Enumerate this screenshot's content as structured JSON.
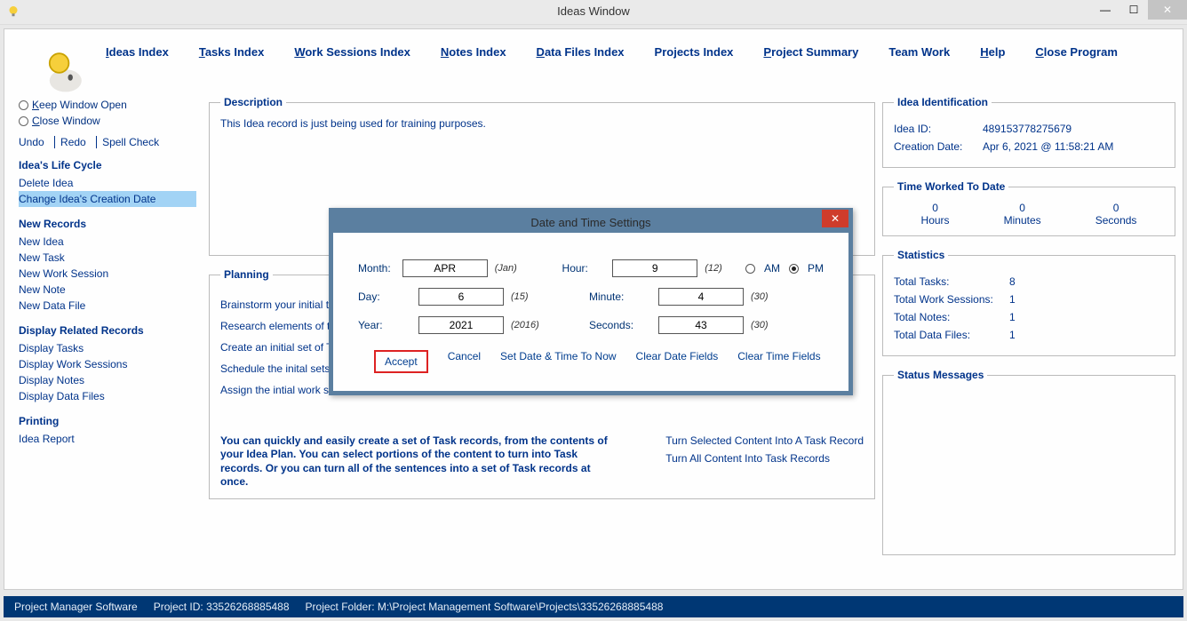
{
  "window": {
    "title": "Ideas Window"
  },
  "menu": {
    "items": [
      "Ideas Index",
      "Tasks Index",
      "Work Sessions Index",
      "Notes Index",
      "Data Files Index",
      "Projects Index",
      "Project Summary",
      "Team Work",
      "Help",
      "Close Program"
    ]
  },
  "left": {
    "keep_open": "Keep Window Open",
    "close_window": "Close Window",
    "undo": "Undo",
    "redo": "Redo",
    "spell": "Spell Check",
    "life_cycle_header": "Idea's Life Cycle",
    "delete_idea": "Delete Idea",
    "change_date": "Change Idea's Creation Date",
    "new_records_header": "New Records",
    "new_idea": "New Idea",
    "new_task": "New Task",
    "new_ws": "New Work Session",
    "new_note": "New Note",
    "new_df": "New Data File",
    "display_header": "Display Related Records",
    "disp_tasks": "Display Tasks",
    "disp_ws": "Display Work Sessions",
    "disp_notes": "Display Notes",
    "disp_df": "Display Data Files",
    "printing_header": "Printing",
    "idea_report": "Idea Report"
  },
  "description": {
    "legend": "Description",
    "text": "This Idea record is just being used for training purposes."
  },
  "planning": {
    "legend": "Planning",
    "lines": [
      "Brainstorm your initial thoughts here.",
      "Research elements of the idea, that you need more information about.",
      "Create an initial set of Tasks.",
      "Schedule the inital sets of Work Sessions for the intial Tasks.",
      "Assign the intial work sessions to team members."
    ],
    "tip": "You can quickly and easily create a set of Task records, from the contents of your Idea Plan. You can select portions of the content to turn into Task records. Or you can turn all of the sentences into a set of Task records at once.",
    "link_sel": "Turn Selected Content Into A Task Record",
    "link_all": "Turn All Content Into Task Records"
  },
  "ident": {
    "legend": "Idea Identification",
    "idea_id_label": "Idea ID:",
    "idea_id": "489153778275679",
    "created_label": "Creation Date:",
    "created": "Apr  6, 2021 @ 11:58:21 AM"
  },
  "time_worked": {
    "legend": "Time Worked To Date",
    "hours_v": "0",
    "hours_l": "Hours",
    "min_v": "0",
    "min_l": "Minutes",
    "sec_v": "0",
    "sec_l": "Seconds"
  },
  "stats": {
    "legend": "Statistics",
    "tt_l": "Total Tasks:",
    "tt_v": "8",
    "tws_l": "Total Work Sessions:",
    "tws_v": "1",
    "tn_l": "Total Notes:",
    "tn_v": "1",
    "tdf_l": "Total Data Files:",
    "tdf_v": "1"
  },
  "status_msgs": {
    "legend": "Status Messages"
  },
  "status_bar": {
    "app": "Project Manager Software",
    "pid": "Project ID:  33526268885488",
    "folder": "Project Folder:  M:\\Project Management Software\\Projects\\33526268885488"
  },
  "dialog": {
    "title": "Date and Time Settings",
    "month_l": "Month:",
    "month_v": "APR",
    "month_h": "(Jan)",
    "day_l": "Day:",
    "day_v": "6",
    "day_h": "(15)",
    "year_l": "Year:",
    "year_v": "2021",
    "year_h": "(2016)",
    "hour_l": "Hour:",
    "hour_v": "9",
    "hour_h": "(12)",
    "min_l": "Minute:",
    "min_v": "4",
    "min_h": "(30)",
    "sec_l": "Seconds:",
    "sec_v": "43",
    "sec_h": "(30)",
    "am": "AM",
    "pm": "PM",
    "ampm_selected": "PM",
    "accept": "Accept",
    "cancel": "Cancel",
    "set_now": "Set Date & Time To Now",
    "clear_date": "Clear Date Fields",
    "clear_time": "Clear Time Fields"
  }
}
